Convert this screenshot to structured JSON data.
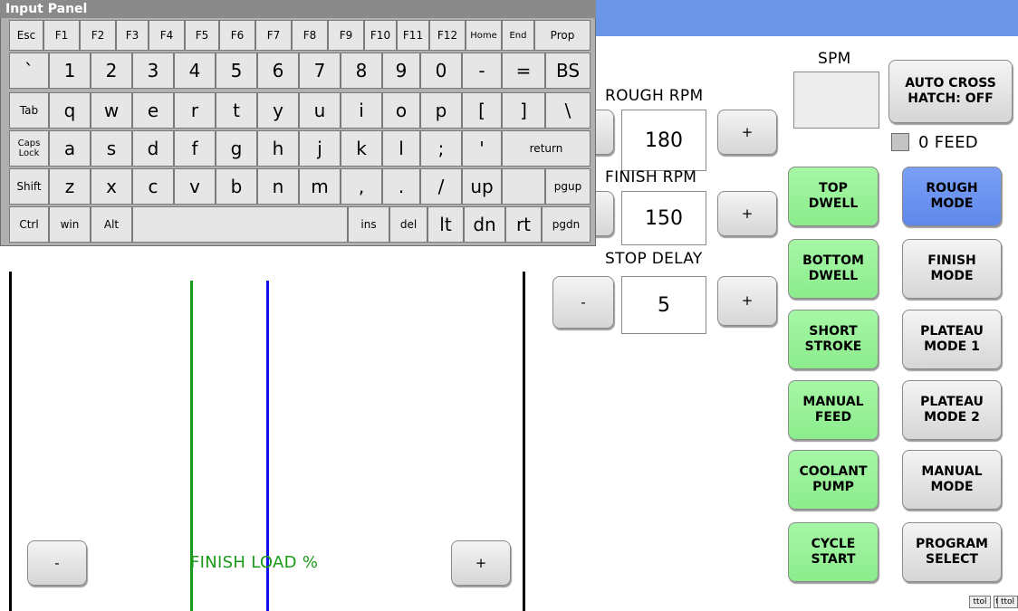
{
  "input_panel": {
    "title": "Input Panel",
    "rows": [
      [
        {
          "id": "esc",
          "label": "Esc"
        },
        {
          "id": "f1",
          "label": "F1"
        },
        {
          "id": "f2",
          "label": "F2"
        },
        {
          "id": "f3",
          "label": "F3"
        },
        {
          "id": "f4",
          "label": "F4"
        },
        {
          "id": "f5",
          "label": "F5"
        },
        {
          "id": "f6",
          "label": "F6"
        },
        {
          "id": "f7",
          "label": "F7"
        },
        {
          "id": "f8",
          "label": "F8"
        },
        {
          "id": "f9",
          "label": "F9"
        },
        {
          "id": "f10",
          "label": "F10"
        },
        {
          "id": "f11",
          "label": "F11"
        },
        {
          "id": "f12",
          "label": "F12"
        },
        {
          "id": "home",
          "label": "Home"
        },
        {
          "id": "end",
          "label": "End"
        },
        {
          "id": "prop",
          "label": "Prop"
        }
      ],
      [
        {
          "id": "backtick",
          "label": "`"
        },
        {
          "id": "1",
          "label": "1"
        },
        {
          "id": "2",
          "label": "2"
        },
        {
          "id": "3",
          "label": "3"
        },
        {
          "id": "4",
          "label": "4"
        },
        {
          "id": "5",
          "label": "5"
        },
        {
          "id": "6",
          "label": "6"
        },
        {
          "id": "7",
          "label": "7"
        },
        {
          "id": "8",
          "label": "8"
        },
        {
          "id": "9",
          "label": "9"
        },
        {
          "id": "0",
          "label": "0"
        },
        {
          "id": "minus",
          "label": "-"
        },
        {
          "id": "equals",
          "label": "="
        },
        {
          "id": "bs",
          "label": "BS"
        }
      ],
      [
        {
          "id": "tab",
          "label": "Tab"
        },
        {
          "id": "q",
          "label": "q"
        },
        {
          "id": "w",
          "label": "w"
        },
        {
          "id": "e",
          "label": "e"
        },
        {
          "id": "r",
          "label": "r"
        },
        {
          "id": "t",
          "label": "t"
        },
        {
          "id": "y",
          "label": "y"
        },
        {
          "id": "u",
          "label": "u"
        },
        {
          "id": "i",
          "label": "i"
        },
        {
          "id": "o",
          "label": "o"
        },
        {
          "id": "p",
          "label": "p"
        },
        {
          "id": "lbracket",
          "label": "["
        },
        {
          "id": "rbracket",
          "label": "]"
        },
        {
          "id": "backslash",
          "label": "\\"
        }
      ],
      [
        {
          "id": "capslock",
          "label": "Caps\nLock"
        },
        {
          "id": "a",
          "label": "a"
        },
        {
          "id": "s",
          "label": "s"
        },
        {
          "id": "d",
          "label": "d"
        },
        {
          "id": "f",
          "label": "f"
        },
        {
          "id": "g",
          "label": "g"
        },
        {
          "id": "h",
          "label": "h"
        },
        {
          "id": "j",
          "label": "j"
        },
        {
          "id": "k",
          "label": "k"
        },
        {
          "id": "l",
          "label": "l"
        },
        {
          "id": "semicolon",
          "label": ";"
        },
        {
          "id": "quote",
          "label": "'"
        },
        {
          "id": "return",
          "label": "return"
        }
      ],
      [
        {
          "id": "shift",
          "label": "Shift"
        },
        {
          "id": "z",
          "label": "z"
        },
        {
          "id": "x",
          "label": "x"
        },
        {
          "id": "c",
          "label": "c"
        },
        {
          "id": "v",
          "label": "v"
        },
        {
          "id": "b",
          "label": "b"
        },
        {
          "id": "n",
          "label": "n"
        },
        {
          "id": "m",
          "label": "m"
        },
        {
          "id": "comma",
          "label": ","
        },
        {
          "id": "period",
          "label": "."
        },
        {
          "id": "slash",
          "label": "/"
        },
        {
          "id": "up",
          "label": "up"
        },
        {
          "id": "blank",
          "label": ""
        },
        {
          "id": "pgup",
          "label": "pgup"
        }
      ],
      [
        {
          "id": "ctrl",
          "label": "Ctrl"
        },
        {
          "id": "win",
          "label": "win"
        },
        {
          "id": "alt",
          "label": "Alt"
        },
        {
          "id": "space",
          "label": ""
        },
        {
          "id": "ins",
          "label": "ins"
        },
        {
          "id": "del",
          "label": "del"
        },
        {
          "id": "lt",
          "label": "lt"
        },
        {
          "id": "dn",
          "label": "dn"
        },
        {
          "id": "rt",
          "label": "rt"
        },
        {
          "id": "pgdn",
          "label": "pgdn"
        }
      ]
    ]
  },
  "plot": {
    "label": "FINISH LOAD %",
    "minus_label": "-",
    "plus_label": "+",
    "green_line_color": "#1a9a1a",
    "blue_line_color": "#1010ee"
  },
  "rough_rpm": {
    "label": "ROUGH RPM",
    "value": "180",
    "plus": "+"
  },
  "finish_rpm": {
    "label": "FINISH RPM",
    "value": "150",
    "plus": "+"
  },
  "stop_delay": {
    "label": "STOP DELAY",
    "value": "5",
    "minus": "-",
    "plus": "+"
  },
  "spm": {
    "label": "SPM",
    "value": ""
  },
  "auto_cross_hatch": "AUTO CROSS\nHATCH: OFF",
  "zero_feed_label": "0 FEED",
  "green_buttons": [
    {
      "id": "top-dwell",
      "label": "TOP\nDWELL"
    },
    {
      "id": "bottom-dwell",
      "label": "BOTTOM\nDWELL"
    },
    {
      "id": "short-stroke",
      "label": "SHORT\nSTROKE"
    },
    {
      "id": "manual-feed",
      "label": "MANUAL\nFEED"
    },
    {
      "id": "coolant-pump",
      "label": "COOLANT\nPUMP"
    },
    {
      "id": "cycle-start",
      "label": "CYCLE\nSTART"
    }
  ],
  "mode_buttons": [
    {
      "id": "rough-mode",
      "label": "ROUGH\nMODE",
      "active": true
    },
    {
      "id": "finish-mode",
      "label": "FINISH\nMODE",
      "active": false
    },
    {
      "id": "plateau-mode-1",
      "label": "PLATEAU\nMODE 1",
      "active": false
    },
    {
      "id": "plateau-mode-2",
      "label": "PLATEAU\nMODE 2",
      "active": false
    },
    {
      "id": "manual-mode",
      "label": "MANUAL\nMODE",
      "active": false
    },
    {
      "id": "program-select",
      "label": "PROGRAM\nSELECT",
      "active": false
    }
  ],
  "tray_icons": [
    "ttol",
    "ttl",
    "ttol"
  ],
  "colors": {
    "accent_blue": "#6b96e6",
    "active_green": "#9cf29c",
    "active_blue": "#6a90f0"
  }
}
